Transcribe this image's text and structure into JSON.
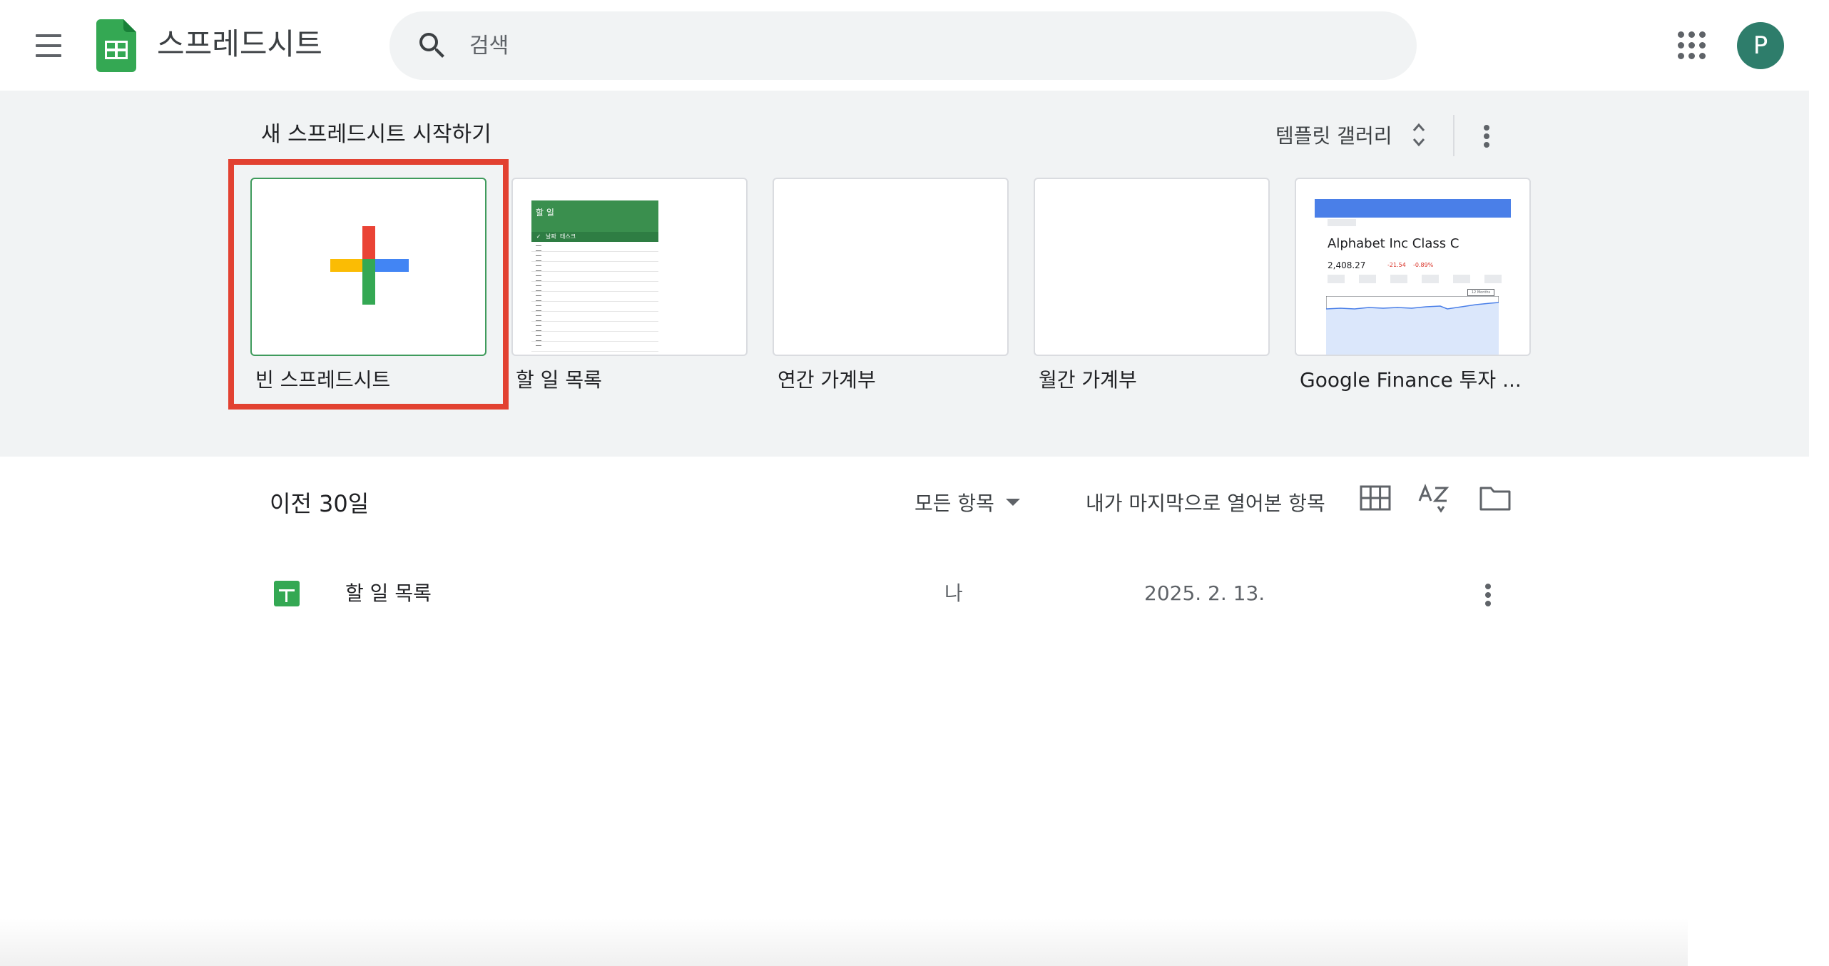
{
  "header": {
    "app_title": "스프레드시트",
    "search": {
      "placeholder": "검색",
      "value": ""
    },
    "menu_icon": "hamburger-menu-icon",
    "logo_icon": "sheets-logo-icon",
    "apps_icon": "apps-grid-icon",
    "avatar_initial": "P",
    "avatar_color": "#2e7d6b"
  },
  "templates": {
    "section_title": "새 스프레드시트 시작하기",
    "gallery_label": "템플릿 갤러리",
    "items": [
      {
        "label": "빈 스프레드시트",
        "selected": true
      },
      {
        "label": "할 일 목록"
      },
      {
        "label": "연간 가계부"
      },
      {
        "label": "월간 가계부"
      },
      {
        "label": "Google Finance 투자 ..."
      }
    ],
    "todo_preview": {
      "title": "할 일",
      "columns": [
        "✓",
        "날짜",
        "태스크"
      ]
    },
    "finance_preview": {
      "stock_name": "Alphabet Inc Class C",
      "price": "2,408.27",
      "change": "-21.54",
      "change_pct": "-0.89%",
      "period_label": "12 Months"
    }
  },
  "recent": {
    "title": "이전 30일",
    "filter_label": "모든 항목",
    "sort_label": "내가 마지막으로 열어본 항목",
    "files": [
      {
        "name": "할 일 목록",
        "owner": "나",
        "date": "2025. 2. 13."
      }
    ]
  },
  "colors": {
    "sheets_green": "#34a853",
    "highlight_red": "#e24131",
    "plus_red": "#ea4335",
    "plus_blue": "#4285f4",
    "plus_yellow": "#fbbc04",
    "plus_green": "#34a853"
  }
}
